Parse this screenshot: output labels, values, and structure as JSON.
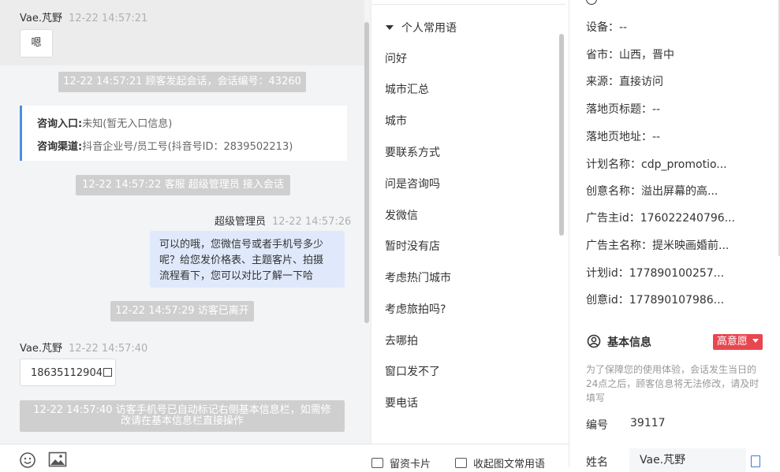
{
  "chat": {
    "visitor_name": "Vae.芃野",
    "msg1_time": "12-22 14:57:21",
    "msg1_text": "嗯",
    "sys1": "12-22 14:57:21 顾客发起会话，会话编号：43260",
    "card": {
      "entry_label": "咨询入口:",
      "entry_value": "未知(暂无入口信息)",
      "channel_label": "咨询渠道:",
      "channel_value": "抖音企业号/员工号(抖音号ID：2839502213)"
    },
    "sys2": "12-22 14:57:22 客服 超级管理员 接入会话",
    "agent_name": "超级管理员",
    "agent_time": "12-22 14:57:26",
    "agent_lines": [
      "可以的哦，您微信号或者手机号多少",
      "呢？给您发价格表、主题客片、拍摄",
      "流程看下，您可以对比了解一下哈"
    ],
    "sys3": "12-22 14:57:29 访客已离开",
    "msg2_time": "12-22 14:57:40",
    "msg2_text": "18635112904",
    "sys4_lines": [
      "12-22 14:57:40 访客手机号已自动标记右侧基本信息栏，如需修",
      "改请在基本信息栏直接操作"
    ]
  },
  "toolbar": {
    "emoji_icon": "smiley-icon",
    "image_icon": "image-icon",
    "card_label": "留资卡片",
    "collapse_label": "收起图文常用语"
  },
  "phrases": {
    "header": "个人常用语",
    "items": [
      "问好",
      "城市汇总",
      "城市",
      "要联系方式",
      "问是咨询吗",
      "发微信",
      "暂时没有店",
      "考虑热门城市",
      "考虑旅拍吗?",
      "去哪拍",
      "窗口发不了",
      "要电话"
    ]
  },
  "right": {
    "device": "设备：--",
    "province": "省市：山西，晋中",
    "source": "来源：直接访问",
    "landing_title": "落地页标题：--",
    "landing_url": "落地页地址：--",
    "plan_name": "计划名称：cdp_promotio...",
    "creative_name": "创意名称：溢出屏幕的高...",
    "advertiser_id": "广告主id：176022240796...",
    "advertiser_name": "广告主名称：提米映画婚前...",
    "plan_id": "计划id：177890100257...",
    "creative_id": "创意id：177890107986...",
    "basic_title": "基本信息",
    "intent_badge": "高意愿",
    "note": "为了保障您的使用体验，会话发生当日的24点之后，顾客信息将无法修改，请及时填写",
    "number_label": "编号",
    "number_value": "39117",
    "name_label": "姓名",
    "name_value": "Vae.芃野"
  },
  "colors": {
    "accent_blue": "#4a90e2",
    "badge_red": "#e8474f",
    "agent_bubble": "#dfe9fb",
    "system_msg": "#cfcfcf"
  }
}
